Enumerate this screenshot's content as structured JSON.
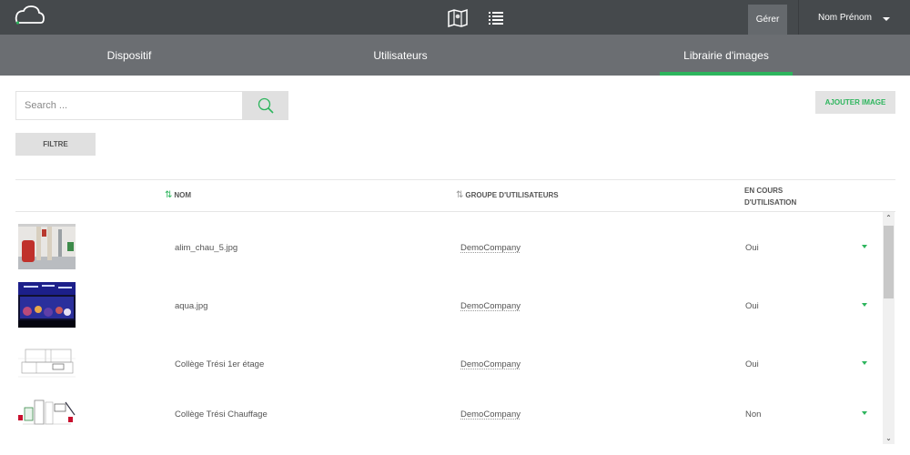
{
  "topbar": {
    "logo_icon": "cloud-icon",
    "center_icons": [
      "map-icon",
      "list-icon"
    ],
    "manage_label": "Gérer",
    "user_name": "Nom Prénom",
    "user_caret_icon": "caret-down-icon"
  },
  "tabs": [
    {
      "label": "Dispositif",
      "active": false
    },
    {
      "label": "Utilisateurs",
      "active": false
    },
    {
      "label": "Librairie d'images",
      "active": true
    }
  ],
  "toolbar": {
    "search_placeholder": "Search ...",
    "search_value": "",
    "search_icon": "search-icon",
    "filter_label": "FILTRE",
    "add_label": "AJOUTER IMAGE"
  },
  "table": {
    "columns": {
      "name": "NOM",
      "group": "GROUPE D'UTILISATEURS",
      "usage_line1": "EN COURS",
      "usage_line2": "D'UTILISATION"
    },
    "sort_icon": "⇅",
    "rows": [
      {
        "thumbnail": "boiler-room-photo",
        "name": "alim_chau_5.jpg",
        "group": "DemoCompany",
        "usage": "Oui"
      },
      {
        "thumbnail": "aquarium-photo",
        "name": "aqua.jpg",
        "group": "DemoCompany",
        "usage": "Oui"
      },
      {
        "thumbnail": "floor-plan-drawing",
        "name": "Collège Trési 1er étage",
        "group": "DemoCompany",
        "usage": "Oui"
      },
      {
        "thumbnail": "heating-schematic",
        "name": "Collège Trési Chauffage",
        "group": "DemoCompany",
        "usage": "Non"
      }
    ]
  },
  "scrollbar": {
    "up_glyph": "⌃",
    "down_glyph": "⌄"
  },
  "colors": {
    "accent": "#2db55d",
    "topbar": "#45494c",
    "tabbar": "#6b6e72"
  }
}
